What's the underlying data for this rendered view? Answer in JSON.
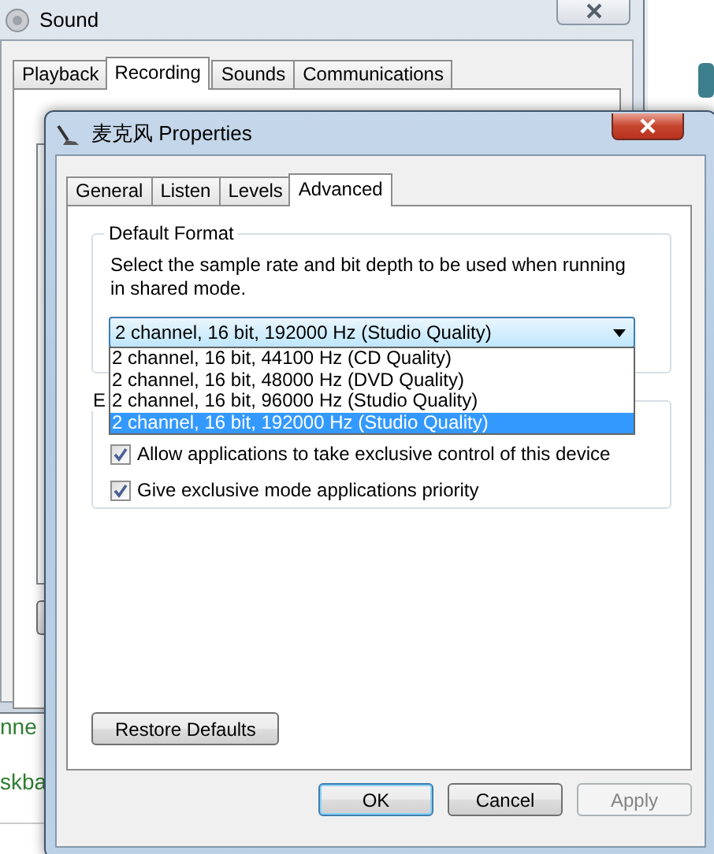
{
  "background_window": {
    "title": "Sound",
    "tabs": [
      {
        "label": "Playback",
        "selected": false
      },
      {
        "label": "Recording",
        "selected": true
      },
      {
        "label": "Sounds",
        "selected": false
      },
      {
        "label": "Communications",
        "selected": false
      }
    ]
  },
  "side_texts": [
    "nne",
    "skba"
  ],
  "dialog": {
    "title": "麦克风 Properties",
    "tabs": [
      {
        "label": "General",
        "selected": false
      },
      {
        "label": "Listen",
        "selected": false
      },
      {
        "label": "Levels",
        "selected": false
      },
      {
        "label": "Advanced",
        "selected": true
      }
    ],
    "default_format": {
      "title": "Default Format",
      "description": "Select the sample rate and bit depth to be used when running in shared mode.",
      "combo": {
        "value": "2 channel, 16 bit, 192000 Hz (Studio Quality)",
        "expanded": true
      },
      "options": [
        {
          "label": "2 channel, 16 bit, 44100 Hz (CD Quality)",
          "selected": false
        },
        {
          "label": "2 channel, 16 bit, 48000 Hz (DVD Quality)",
          "selected": false
        },
        {
          "label": "2 channel, 16 bit, 96000 Hz (Studio Quality)",
          "selected": false
        },
        {
          "label": "2 channel, 16 bit, 192000 Hz (Studio Quality)",
          "selected": true
        }
      ]
    },
    "exclusive_mode": {
      "title": "E",
      "checkboxes": [
        {
          "label": "Allow applications to take exclusive control of this device",
          "checked": true
        },
        {
          "label": "Give exclusive mode applications priority",
          "checked": true
        }
      ]
    },
    "restore_button": "Restore Defaults",
    "buttons": [
      {
        "label": "OK",
        "kind": "default",
        "disabled": false
      },
      {
        "label": "Cancel",
        "kind": "normal",
        "disabled": false
      },
      {
        "label": "Apply",
        "kind": "normal",
        "disabled": true
      }
    ]
  }
}
